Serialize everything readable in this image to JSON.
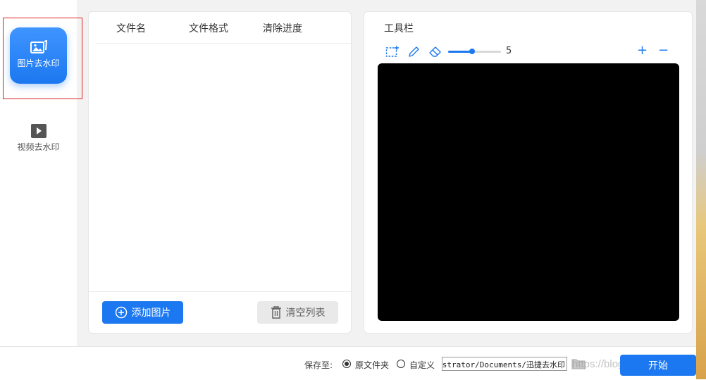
{
  "sidebar": {
    "items": [
      {
        "label": "图片去水印",
        "icon": "image-icon",
        "active": true
      },
      {
        "label": "视频去水印",
        "icon": "play-video-icon",
        "active": false
      }
    ]
  },
  "file_list": {
    "columns": [
      "文件名",
      "文件格式",
      "清除进度"
    ],
    "rows": [],
    "add_button": "添加图片",
    "clear_button": "清空列表"
  },
  "toolbar": {
    "title": "工具栏",
    "tools": [
      "rect-select-icon",
      "pen-icon",
      "eraser-icon"
    ],
    "brush_size": 5,
    "brush_size_fraction": 0.45,
    "zoom_in": "+",
    "zoom_out": "−"
  },
  "bottom": {
    "save_label": "保存至:",
    "option_original": "原文件夹",
    "option_custom": "自定义",
    "selected": "original",
    "path": "C:/Users/Administrator/Documents/迅捷去水印",
    "start_button": "开始",
    "watermark": "https://blog.csdn.net/doublerich"
  },
  "colors": {
    "accent": "#1c78f0",
    "preview_bg": "#000000",
    "highlight": "#e02020"
  }
}
